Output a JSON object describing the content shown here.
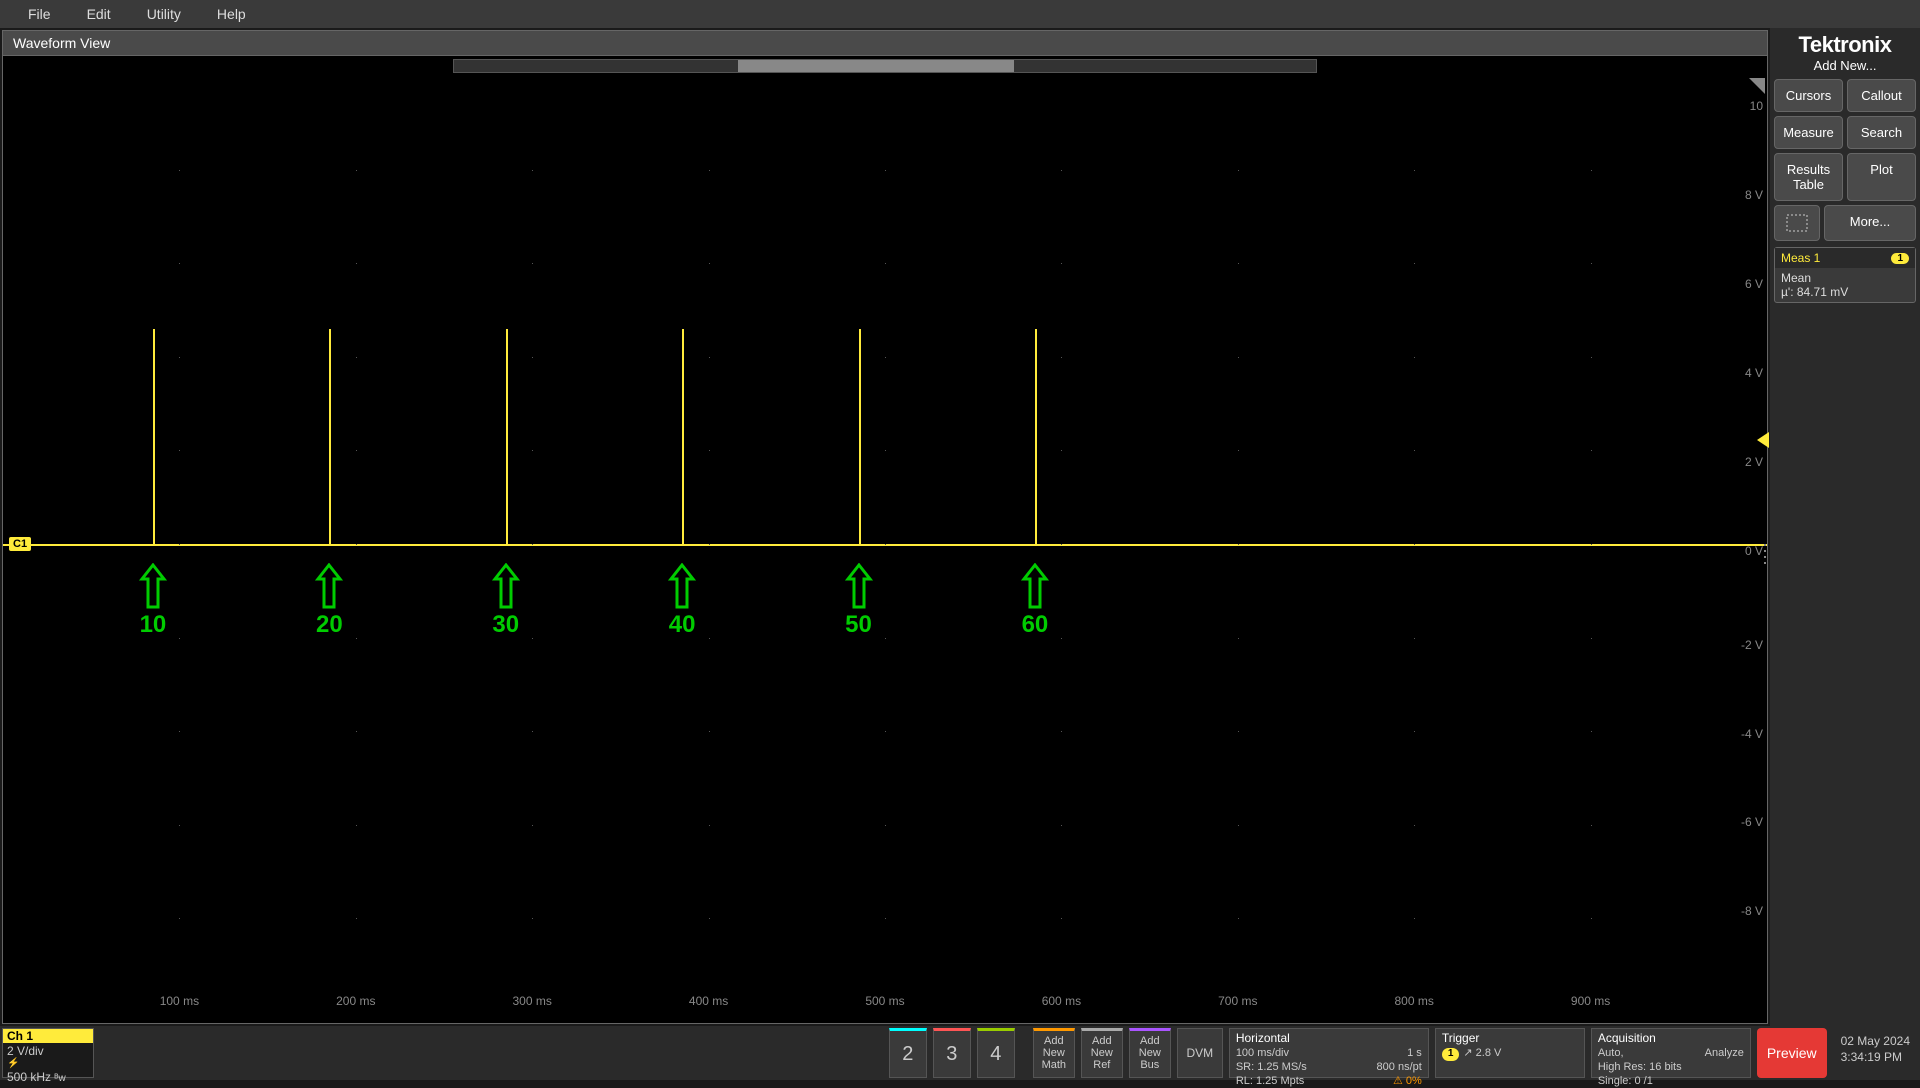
{
  "menubar": [
    "File",
    "Edit",
    "Utility",
    "Help"
  ],
  "brand": "Tektronix",
  "waveform_view_title": "Waveform View",
  "right_panel": {
    "add_new": "Add New...",
    "buttons": {
      "cursors": "Cursors",
      "callout": "Callout",
      "measure": "Measure",
      "search": "Search",
      "results_table": "Results\nTable",
      "plot": "Plot",
      "more": "More..."
    },
    "meas": {
      "title": "Meas 1",
      "badge": "1",
      "stat_label": "Mean",
      "value": "µ': 84.71 mV"
    }
  },
  "y_axis": [
    {
      "label": "10",
      "pct": 2.5
    },
    {
      "label": "8 V",
      "pct": 12
    },
    {
      "label": "6 V",
      "pct": 21.5
    },
    {
      "label": "4 V",
      "pct": 31
    },
    {
      "label": "2 V",
      "pct": 40.5
    },
    {
      "label": "0 V",
      "pct": 50
    },
    {
      "label": "-2 V",
      "pct": 60
    },
    {
      "label": "-4 V",
      "pct": 69.5
    },
    {
      "label": "-6 V",
      "pct": 79
    },
    {
      "label": "-8 V",
      "pct": 88.5
    }
  ],
  "x_axis": [
    {
      "label": "100 ms",
      "pct": 10
    },
    {
      "label": "200 ms",
      "pct": 20
    },
    {
      "label": "300 ms",
      "pct": 30
    },
    {
      "label": "400 ms",
      "pct": 40
    },
    {
      "label": "500 ms",
      "pct": 50
    },
    {
      "label": "600 ms",
      "pct": 60
    },
    {
      "label": "700 ms",
      "pct": 70
    },
    {
      "label": "800 ms",
      "pct": 80
    },
    {
      "label": "900 ms",
      "pct": 90
    }
  ],
  "channel_badge": "C1",
  "pulses_pct": [
    8.5,
    18.5,
    28.5,
    38.5,
    48.5,
    58.5
  ],
  "arrows": [
    {
      "label": "10",
      "pct": 8.5
    },
    {
      "label": "20",
      "pct": 18.5
    },
    {
      "label": "30",
      "pct": 28.5
    },
    {
      "label": "40",
      "pct": 38.5
    },
    {
      "label": "50",
      "pct": 48.5
    },
    {
      "label": "60",
      "pct": 58.5
    }
  ],
  "bottom": {
    "ch": {
      "name": "Ch 1",
      "scale": "2 V/div",
      "bw": "500 kHz"
    },
    "num_buttons": [
      "2",
      "3",
      "4"
    ],
    "add_buttons": [
      {
        "l1": "Add",
        "l2": "New",
        "l3": "Math"
      },
      {
        "l1": "Add",
        "l2": "New",
        "l3": "Ref"
      },
      {
        "l1": "Add",
        "l2": "New",
        "l3": "Bus"
      }
    ],
    "dvm": "DVM",
    "horizontal": {
      "title": "Horizontal",
      "l1a": "100 ms/div",
      "l1b": "1 s",
      "l2a": "SR: 1.25 MS/s",
      "l2b": "800 ns/pt",
      "l3a": "RL: 1.25 Mpts",
      "l3b": "0%"
    },
    "trigger": {
      "title": "Trigger",
      "badge": "1",
      "edge": "↗",
      "level": "2.8 V"
    },
    "acquisition": {
      "title": "Acquisition",
      "l1a": "Auto,",
      "l1b": "Analyze",
      "l2": "High Res: 16 bits",
      "l3": "Single: 0 /1"
    },
    "preview": "Preview",
    "date": "02 May 2024",
    "time": "3:34:19 PM"
  },
  "chart_data": {
    "type": "line",
    "title": "Waveform View",
    "channel": "Ch 1",
    "x_unit": "ms",
    "y_unit": "V",
    "xlim": [
      0,
      1000
    ],
    "ylim": [
      -10,
      10
    ],
    "baseline_v": 0,
    "pulse_amplitude_v": 5,
    "pulse_times_ms": [
      85,
      185,
      285,
      385,
      485,
      585
    ],
    "annotations": [
      {
        "x_ms": 85,
        "text": "10"
      },
      {
        "x_ms": 185,
        "text": "20"
      },
      {
        "x_ms": 285,
        "text": "30"
      },
      {
        "x_ms": 385,
        "text": "40"
      },
      {
        "x_ms": 485,
        "text": "50"
      },
      {
        "x_ms": 585,
        "text": "60"
      }
    ],
    "trigger_level_v": 2.8
  }
}
